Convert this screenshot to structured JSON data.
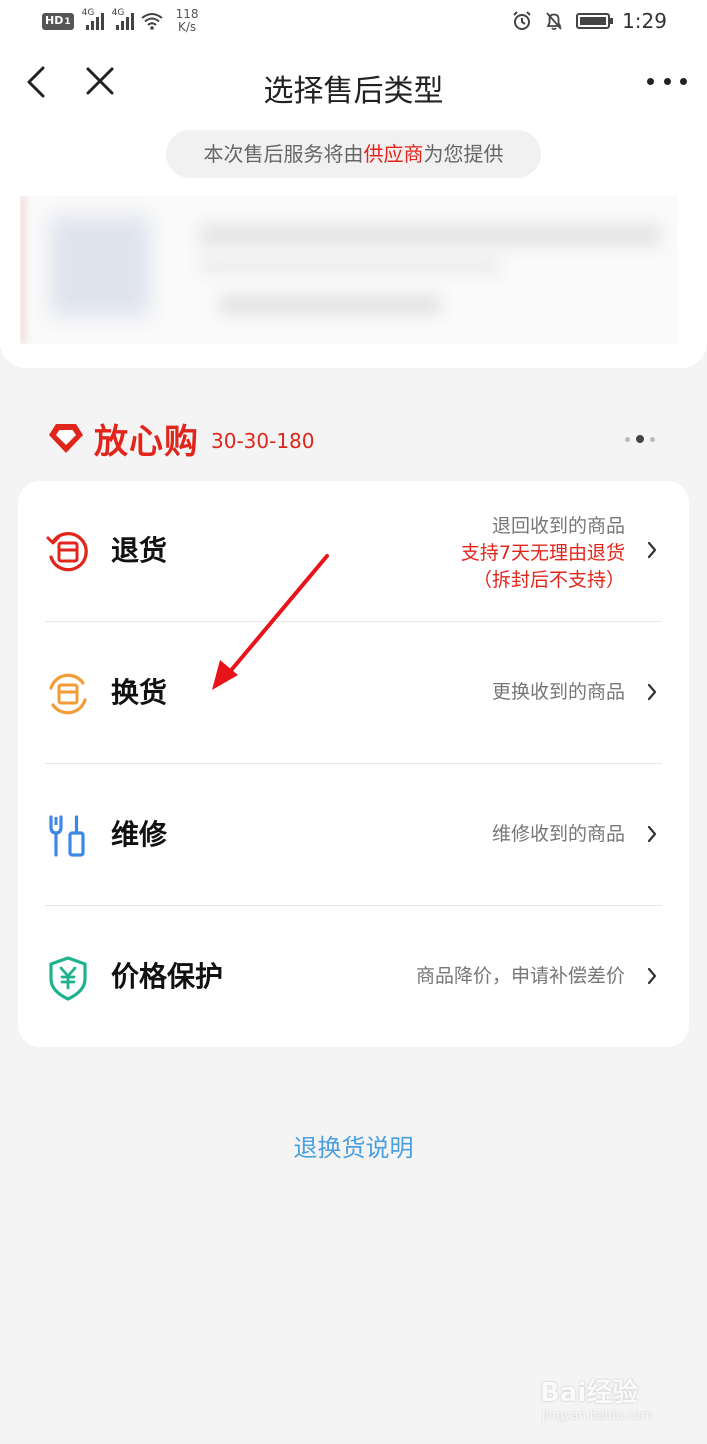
{
  "status_bar": {
    "hd": "HD",
    "hd_sub": "1",
    "net_tag_1": "4G",
    "net_tag_2": "4G",
    "speed_value": "118",
    "speed_unit": "K/s",
    "time": "1:29",
    "icons": [
      "hd-icon",
      "signal-icon",
      "signal-icon",
      "wifi-icon",
      "alarm-icon",
      "mute-bell-icon",
      "battery-icon"
    ]
  },
  "nav": {
    "title": "选择售后类型",
    "icons": [
      "back-icon",
      "close-icon",
      "more-icon"
    ]
  },
  "notice": {
    "prefix": "本次售后服务将由",
    "highlight": "供应商",
    "suffix": "为您提供"
  },
  "brand": {
    "name": "放心购",
    "code": "30-30-180"
  },
  "options": [
    {
      "label": "退货",
      "icon": "return-box-icon",
      "desc": "退回收到的商品",
      "desc_red_1": "支持7天无理由退货",
      "desc_red_2": "（拆封后不支持）"
    },
    {
      "label": "换货",
      "icon": "exchange-box-icon",
      "desc": "更换收到的商品"
    },
    {
      "label": "维修",
      "icon": "repair-tools-icon",
      "desc": "维修收到的商品"
    },
    {
      "label": "价格保护",
      "icon": "price-shield-icon",
      "desc": "商品降价，申请补偿差价"
    }
  ],
  "footer": {
    "link": "退换货说明"
  },
  "watermark": {
    "text": "Bai经验",
    "sub": "jingyan.baidu.com"
  },
  "colors": {
    "accent_red": "#e1251b",
    "link_blue": "#4a9fde",
    "exchange_orange": "#f39b36",
    "repair_blue": "#3f87e6",
    "price_green": "#1fb28f"
  }
}
